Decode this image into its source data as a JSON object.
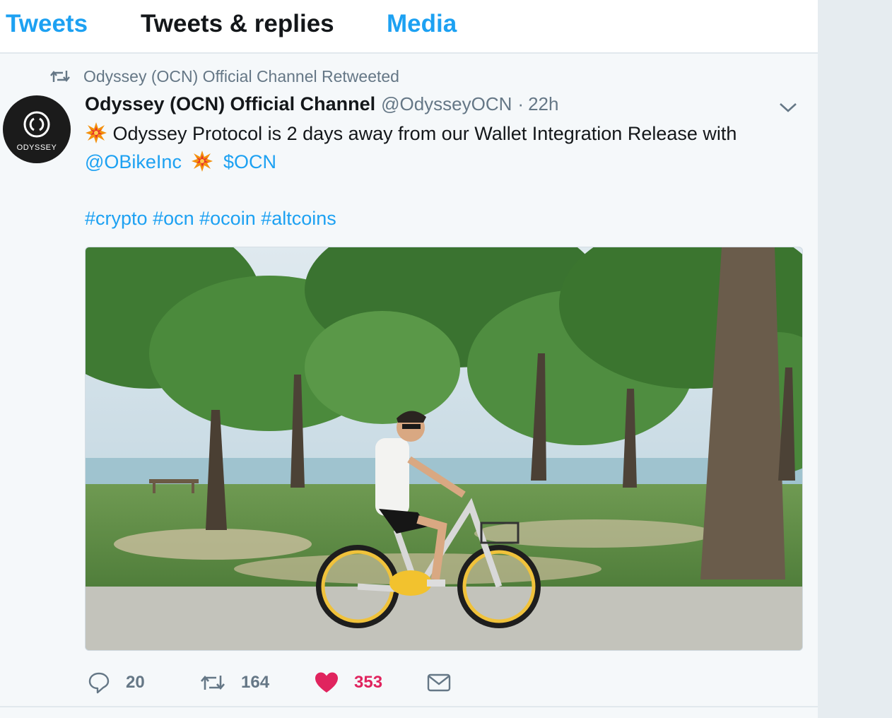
{
  "tabs": [
    {
      "label": "Tweets",
      "active": true
    },
    {
      "label": "Tweets & replies",
      "active": false
    },
    {
      "label": "Media",
      "active": false
    }
  ],
  "tweet": {
    "context": "Odyssey (OCN) Official Channel Retweeted",
    "avatar_text": "ODYSSEY",
    "fullname": "Odyssey (OCN) Official Channel",
    "screen_name": "@OdysseyOCN",
    "separator": "·",
    "time": "22h",
    "text": {
      "line1": "Odyssey Protocol is 2 days away from our Wallet Integration  Release with",
      "mention": "@OBikeInc",
      "cashtag": "$OCN",
      "hashtags": [
        "#crypto",
        "#ocn",
        "#ocoin",
        "#altcoins"
      ]
    },
    "emoji_icon": "collision-emoji",
    "photo_icon": "photo-man-riding-yellow-bike-in-park",
    "actions": {
      "replies": "20",
      "retweets": "164",
      "likes": "353"
    }
  },
  "colors": {
    "accent": "#1da1f2",
    "like": "#e0245e",
    "muted": "#657786",
    "text": "#14171a",
    "background": "#f5f8fa"
  }
}
